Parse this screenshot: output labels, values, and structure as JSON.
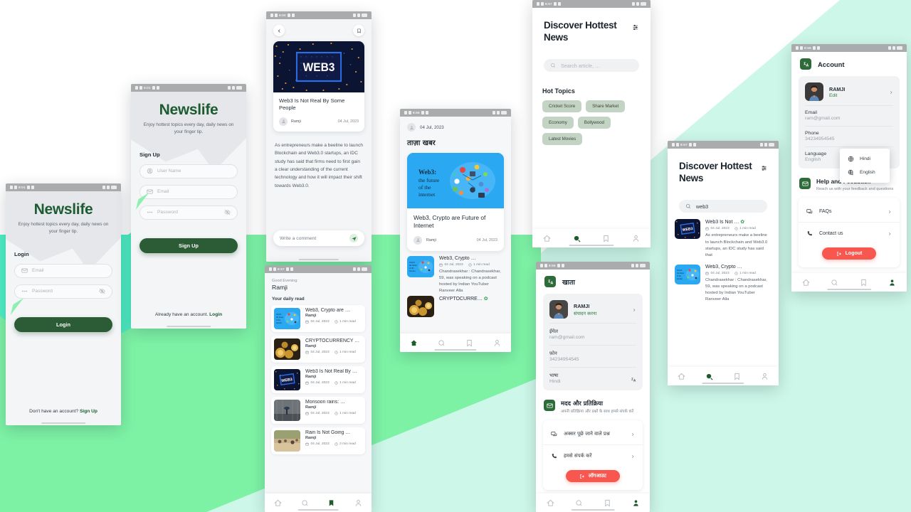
{
  "app": {
    "brand": "Newslife",
    "tagline": "Enjoy hottest topics every day, daily news on your finger tip."
  },
  "colors": {
    "primary_green": "#2c5c36",
    "accent_green": "#1d5c32",
    "logout_red": "#f8574f",
    "chip_green": "#c3d3c4",
    "mint": "#4ef0c5",
    "green_block": "#7df2a5",
    "pale_mint": "#cdf7e8"
  },
  "login_screen": {
    "status_time": "9:01",
    "brand": "Newslife",
    "tagline": "Enjoy hottest topics every day, daily news on your finger tip.",
    "section_label": "Login",
    "email_placeholder": "Email",
    "password_placeholder": "Password",
    "submit_label": "Login",
    "footer_text": "Don't have an account?",
    "footer_link": "Sign Up"
  },
  "signup_screen": {
    "status_time": "9:01",
    "brand": "Newslife",
    "tagline": "Enjoy hottest topics every day, daily news on your finger tip.",
    "section_label": "Sign Up",
    "username_placeholder": "User Name",
    "email_placeholder": "Email",
    "password_placeholder": "Password",
    "submit_label": "Sign Up",
    "footer_text": "Already have an account.",
    "footer_link": "Login"
  },
  "article_detail": {
    "status_time": "9:00",
    "title": "Web3 Is Not Real By Some People",
    "author": "Ramji",
    "date": "04 Jul, 2023",
    "body": "As entrepreneurs make a beeline to launch Blockchain and Web3.0 startups, an IDC study has said that firms need to first gain a clear understanding of the current technology and how it will impact their shift towards Web3.0.",
    "comment_placeholder": "Write a comment",
    "hero_caption": "WEB3"
  },
  "feed_hindi": {
    "status_time": "8:56",
    "date": "04 Jul, 2023",
    "heading": "ताज़ा खबर",
    "featured": {
      "title": "Web3, Crypto are Future of Internet",
      "author": "Ramji",
      "date": "04 Jul, 2023",
      "image_caption": "Web3:\nthe future\nof the\ninternet"
    },
    "items": [
      {
        "title": "Web3, Crypto …",
        "date": "04 Jul, 2023",
        "read": "1 min read",
        "desc": "Chandrasekhar : Chandrasekhar, 59, was speaking on a podcast hosted by Indian YouTuber Ranveer Alla"
      },
      {
        "title": "CRYPTOCURRE…",
        "date": "",
        "read": "",
        "desc": ""
      }
    ],
    "nav": [
      "home",
      "search",
      "bookmark",
      "profile"
    ]
  },
  "daily_read": {
    "status_time": "8:57",
    "greeting": "Good Evening",
    "user": "Ramji",
    "section": "Your daily read",
    "items": [
      {
        "title": "Web3, Crypto are …",
        "author": "Ramji",
        "date": "04 Jul, 2023",
        "read": "1 min read",
        "thumb": "web3-crypto"
      },
      {
        "title": "CRYPTOCURRENCY …",
        "author": "Ramji",
        "date": "04 Jul, 2023",
        "read": "1 min read",
        "thumb": "coins"
      },
      {
        "title": "Web3 Is Not Real By …",
        "author": "Ramji",
        "date": "04 Jul, 2023",
        "read": "1 min read",
        "thumb": "web3-chip"
      },
      {
        "title": "Monsoon rains: …",
        "author": "Ramji",
        "date": "04 Jul, 2023",
        "read": "1 min read",
        "thumb": "rain"
      },
      {
        "title": "Rain Is Not Going …",
        "author": "Ramji",
        "date": "04 Jul, 2023",
        "read": "2 min read",
        "thumb": "street"
      }
    ]
  },
  "discover": {
    "status_time": "8:57",
    "title": "Discover Hottest News",
    "search_placeholder": "Search article, …",
    "hot_topics_label": "Hot Topics",
    "topics": [
      "Cricket Score",
      "Share Market",
      "Economy",
      "Bollywood",
      "Latest Movies"
    ]
  },
  "search_results": {
    "status_time": "8:57",
    "title": "Discover Hottest News",
    "query": "web3",
    "results": [
      {
        "title": "Web3 Is Not …",
        "date": "04 Jul, 2023",
        "read": "1 min read",
        "desc": "As entrepreneurs make a beeline to launch Blockchain and Web3.0 startups, an IDC study has said that"
      },
      {
        "title": "Web3, Crypto …",
        "date": "04 Jul, 2023",
        "read": "1 min read",
        "desc": "Chandrasekhar : Chandrasekhar, 59, was speaking on a podcast hosted by Indian YouTuber Ranveer Alla"
      }
    ]
  },
  "account_en": {
    "status_time": "8:56",
    "title": "Account",
    "user_name": "RAMJI",
    "edit_label": "Edit",
    "email_label": "Email",
    "email_value": "ram@gmail.com",
    "phone_label": "Phone",
    "phone_value": "34234954545",
    "language_label": "Language",
    "language_value": "English",
    "help_title": "Help and Feedback",
    "help_sub": "Reach us with your feedback and questions",
    "faq_label": "FAQs",
    "contact_label": "Contact us",
    "logout_label": "Logout",
    "lang_options": [
      "Hindi",
      "English"
    ]
  },
  "account_hi": {
    "status_time": "8:56",
    "title": "खाता",
    "user_name": "RAMJI",
    "edit_label": "संपादन करना",
    "email_label": "ईमेल",
    "email_value": "ram@gmail.com",
    "phone_label": "फ़ोन",
    "phone_value": "34234954545",
    "language_label": "भाषा",
    "language_value": "Hindi",
    "help_title": "मदद और प्रतिक्रिया",
    "help_sub": "अपनी प्रतिक्रिया और प्रश्नों के साथ हमसे संपर्क करें",
    "faq_label": "अक्सर पूछे जाने वाले प्रश्न",
    "contact_label": "हमसे संपर्क करें",
    "logout_label": "लॉगआउट"
  }
}
